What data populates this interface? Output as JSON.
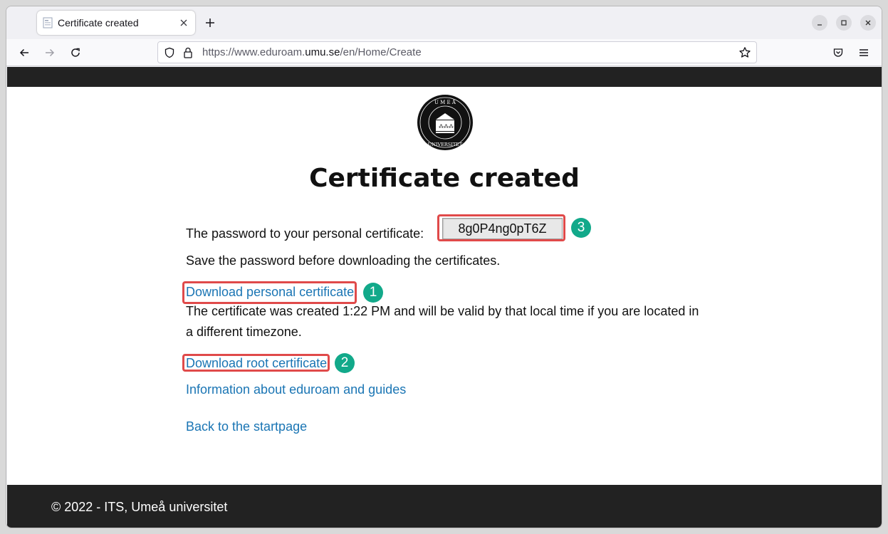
{
  "browser": {
    "tab_title": "Certificate created",
    "url_prefix": "https://www.eduroam.",
    "url_domain": "umu.se",
    "url_path": "/en/Home/Create"
  },
  "page": {
    "heading": "Certificate created",
    "password_label": "The password to your personal certificate:",
    "password_value": "8g0P4ng0pT6Z",
    "save_notice": "Save the password before downloading the certificates.",
    "download_personal": "Download personal certificate",
    "validity_line1": "The certificate was created 1:22 PM and will be valid by that local time if you are located in",
    "validity_line2": "a different timezone.",
    "download_root": "Download root certificate",
    "info_link": "Information about eduroam and guides",
    "back_link": "Back to the startpage",
    "footer": "© 2022 - ITS, Umeå universitet"
  },
  "annotations": {
    "badge_1": "1",
    "badge_2": "2",
    "badge_3": "3"
  },
  "colors": {
    "link": "#1a75b4",
    "highlight": "#e04a4a",
    "badge": "#12a98a",
    "band": "#222222"
  }
}
